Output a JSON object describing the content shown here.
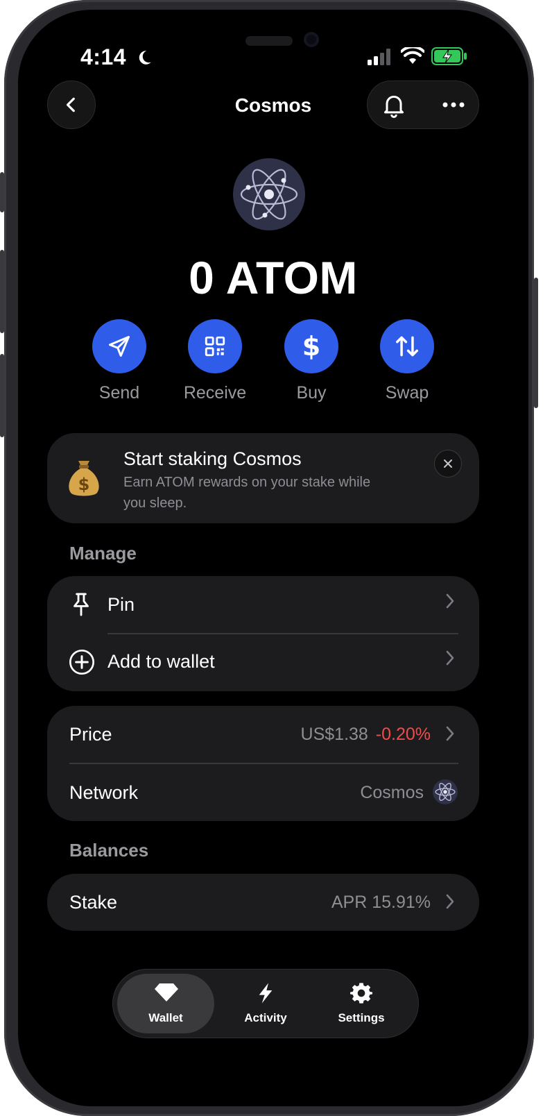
{
  "status_bar": {
    "time": "4:14"
  },
  "header": {
    "title": "Cosmos"
  },
  "asset": {
    "amount": "0 ATOM"
  },
  "actions": [
    {
      "label": "Send",
      "icon": "send-icon"
    },
    {
      "label": "Receive",
      "icon": "qr-code-icon"
    },
    {
      "label": "Buy",
      "icon": "dollar-icon"
    },
    {
      "label": "Swap",
      "icon": "swap-arrows-icon"
    }
  ],
  "banner": {
    "title": "Start staking Cosmos",
    "subtitle_line1": "Earn ATOM rewards on your stake while",
    "subtitle_line2": "you sleep.",
    "icon": "money-bag-icon"
  },
  "manage": {
    "label": "Manage",
    "items": [
      {
        "label": "Pin",
        "icon": "pin-icon"
      },
      {
        "label": "Add to wallet",
        "icon": "plus-circle-icon"
      }
    ]
  },
  "info": {
    "price_label": "Price",
    "price_value": "US$1.38",
    "price_change": "-0.20%",
    "network_label": "Network",
    "network_value": "Cosmos"
  },
  "balances": {
    "label": "Balances",
    "stake_label": "Stake",
    "stake_value": "APR 15.91%"
  },
  "tabbar": {
    "tabs": [
      {
        "label": "Wallet",
        "icon": "gem-icon",
        "active": true
      },
      {
        "label": "Activity",
        "icon": "lightning-icon",
        "active": false
      },
      {
        "label": "Settings",
        "icon": "gear-icon",
        "active": false
      }
    ]
  },
  "colors": {
    "accent": "#2f5de9",
    "negative": "#f04b4b",
    "battery": "#34c759"
  }
}
